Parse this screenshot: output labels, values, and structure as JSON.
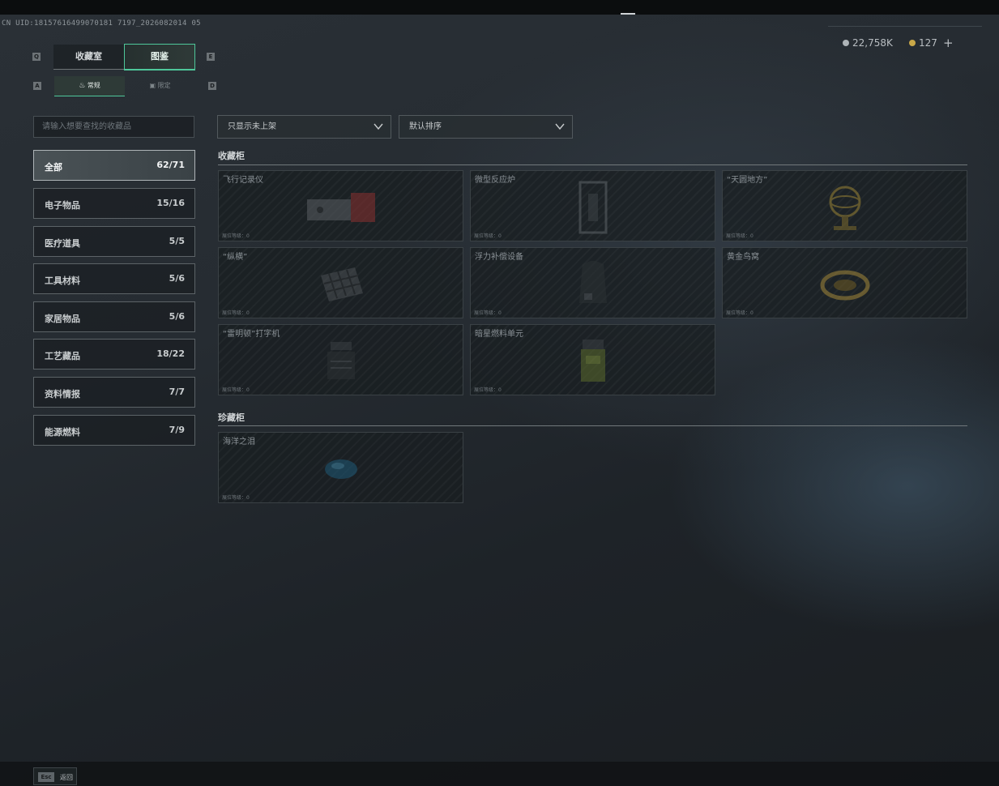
{
  "header": {
    "uid": "CN UID:18157616499070181 7197_2026082014 05",
    "currency_silver": "22,758K",
    "currency_gold": "127",
    "add_label": "+"
  },
  "tabs": {
    "key_left": "Q",
    "key_right": "E",
    "items": [
      {
        "label": "收藏室"
      },
      {
        "label": "图鉴"
      }
    ]
  },
  "subtabs": {
    "key_left": "A",
    "key_right": "D",
    "items": [
      {
        "label": "常规"
      },
      {
        "label": "限定"
      }
    ]
  },
  "sidebar": {
    "search_placeholder": "请输入想要查找的收藏品",
    "categories": [
      {
        "label": "全部",
        "count": "62/71"
      },
      {
        "label": "电子物品",
        "count": "15/16"
      },
      {
        "label": "医疗道具",
        "count": "5/5"
      },
      {
        "label": "工具材料",
        "count": "5/6"
      },
      {
        "label": "家居物品",
        "count": "5/6"
      },
      {
        "label": "工艺藏品",
        "count": "18/22"
      },
      {
        "label": "资料情报",
        "count": "7/7"
      },
      {
        "label": "能源燃料",
        "count": "7/9"
      }
    ]
  },
  "filters": {
    "display_filter": "只显示未上架",
    "sort": "默认排序"
  },
  "sections": [
    {
      "title": "收藏柜",
      "items": [
        {
          "name": "飞行记录仪",
          "slot": "展位等级：0",
          "icon": "flight-recorder-icon"
        },
        {
          "name": "微型反应炉",
          "slot": "展位等级：0",
          "icon": "reactor-icon"
        },
        {
          "name": "“天圆地方”",
          "slot": "展位等级：0",
          "icon": "armillary-icon"
        },
        {
          "name": "“纵横”",
          "slot": "展位等级：0",
          "icon": "board-icon"
        },
        {
          "name": "浮力补偿设备",
          "slot": "展位等级：0",
          "icon": "buoyancy-vest-icon"
        },
        {
          "name": "黄金鸟窝",
          "slot": "展位等级：0",
          "icon": "golden-nest-icon"
        },
        {
          "name": "“雷明顿”打字机",
          "slot": "展位等级：0",
          "icon": "typewriter-icon"
        },
        {
          "name": "暗星燃料单元",
          "slot": "展位等级：0",
          "icon": "fuel-cell-icon"
        }
      ]
    },
    {
      "title": "珍藏柜",
      "items": [
        {
          "name": "海洋之泪",
          "slot": "展位等级：0",
          "icon": "ocean-tear-gem-icon"
        }
      ]
    }
  ],
  "footer": {
    "esc_key": "Esc",
    "back_label": "返回"
  }
}
